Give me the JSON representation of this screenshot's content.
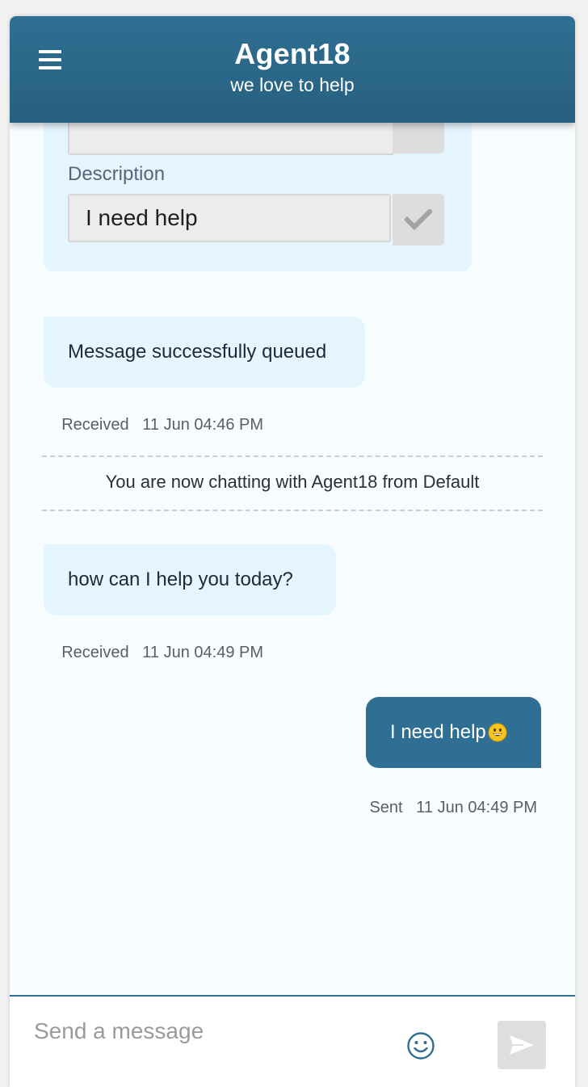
{
  "header": {
    "title": "Agent18",
    "subtitle": "we love to help",
    "menu_icon": "hamburger-menu-icon"
  },
  "form": {
    "description_label": "Description",
    "description_value": "I need help",
    "submit_icon": "checkmark-icon"
  },
  "messages": [
    {
      "direction": "received",
      "text": "Message successfully queued",
      "status": "Received",
      "timestamp": "11 Jun 04:46 PM"
    },
    {
      "direction": "received",
      "text": "how can I help you today?",
      "status": "Received",
      "timestamp": "11 Jun 04:49 PM"
    },
    {
      "direction": "sent",
      "text": "I need help",
      "emoji": "smiling-face-emoji",
      "status": "Sent",
      "timestamp": "11 Jun 04:49 PM"
    }
  ],
  "system_message": "You are now chatting with Agent18 from Default",
  "composer": {
    "placeholder": "Send a message",
    "emoji_icon": "smiley-icon",
    "send_icon": "send-arrow-icon"
  },
  "colors": {
    "header": "#2f6f93",
    "incoming_bubble": "#e5f5fe",
    "outgoing_bubble": "#2f6f93",
    "background": "#f7fcff"
  }
}
